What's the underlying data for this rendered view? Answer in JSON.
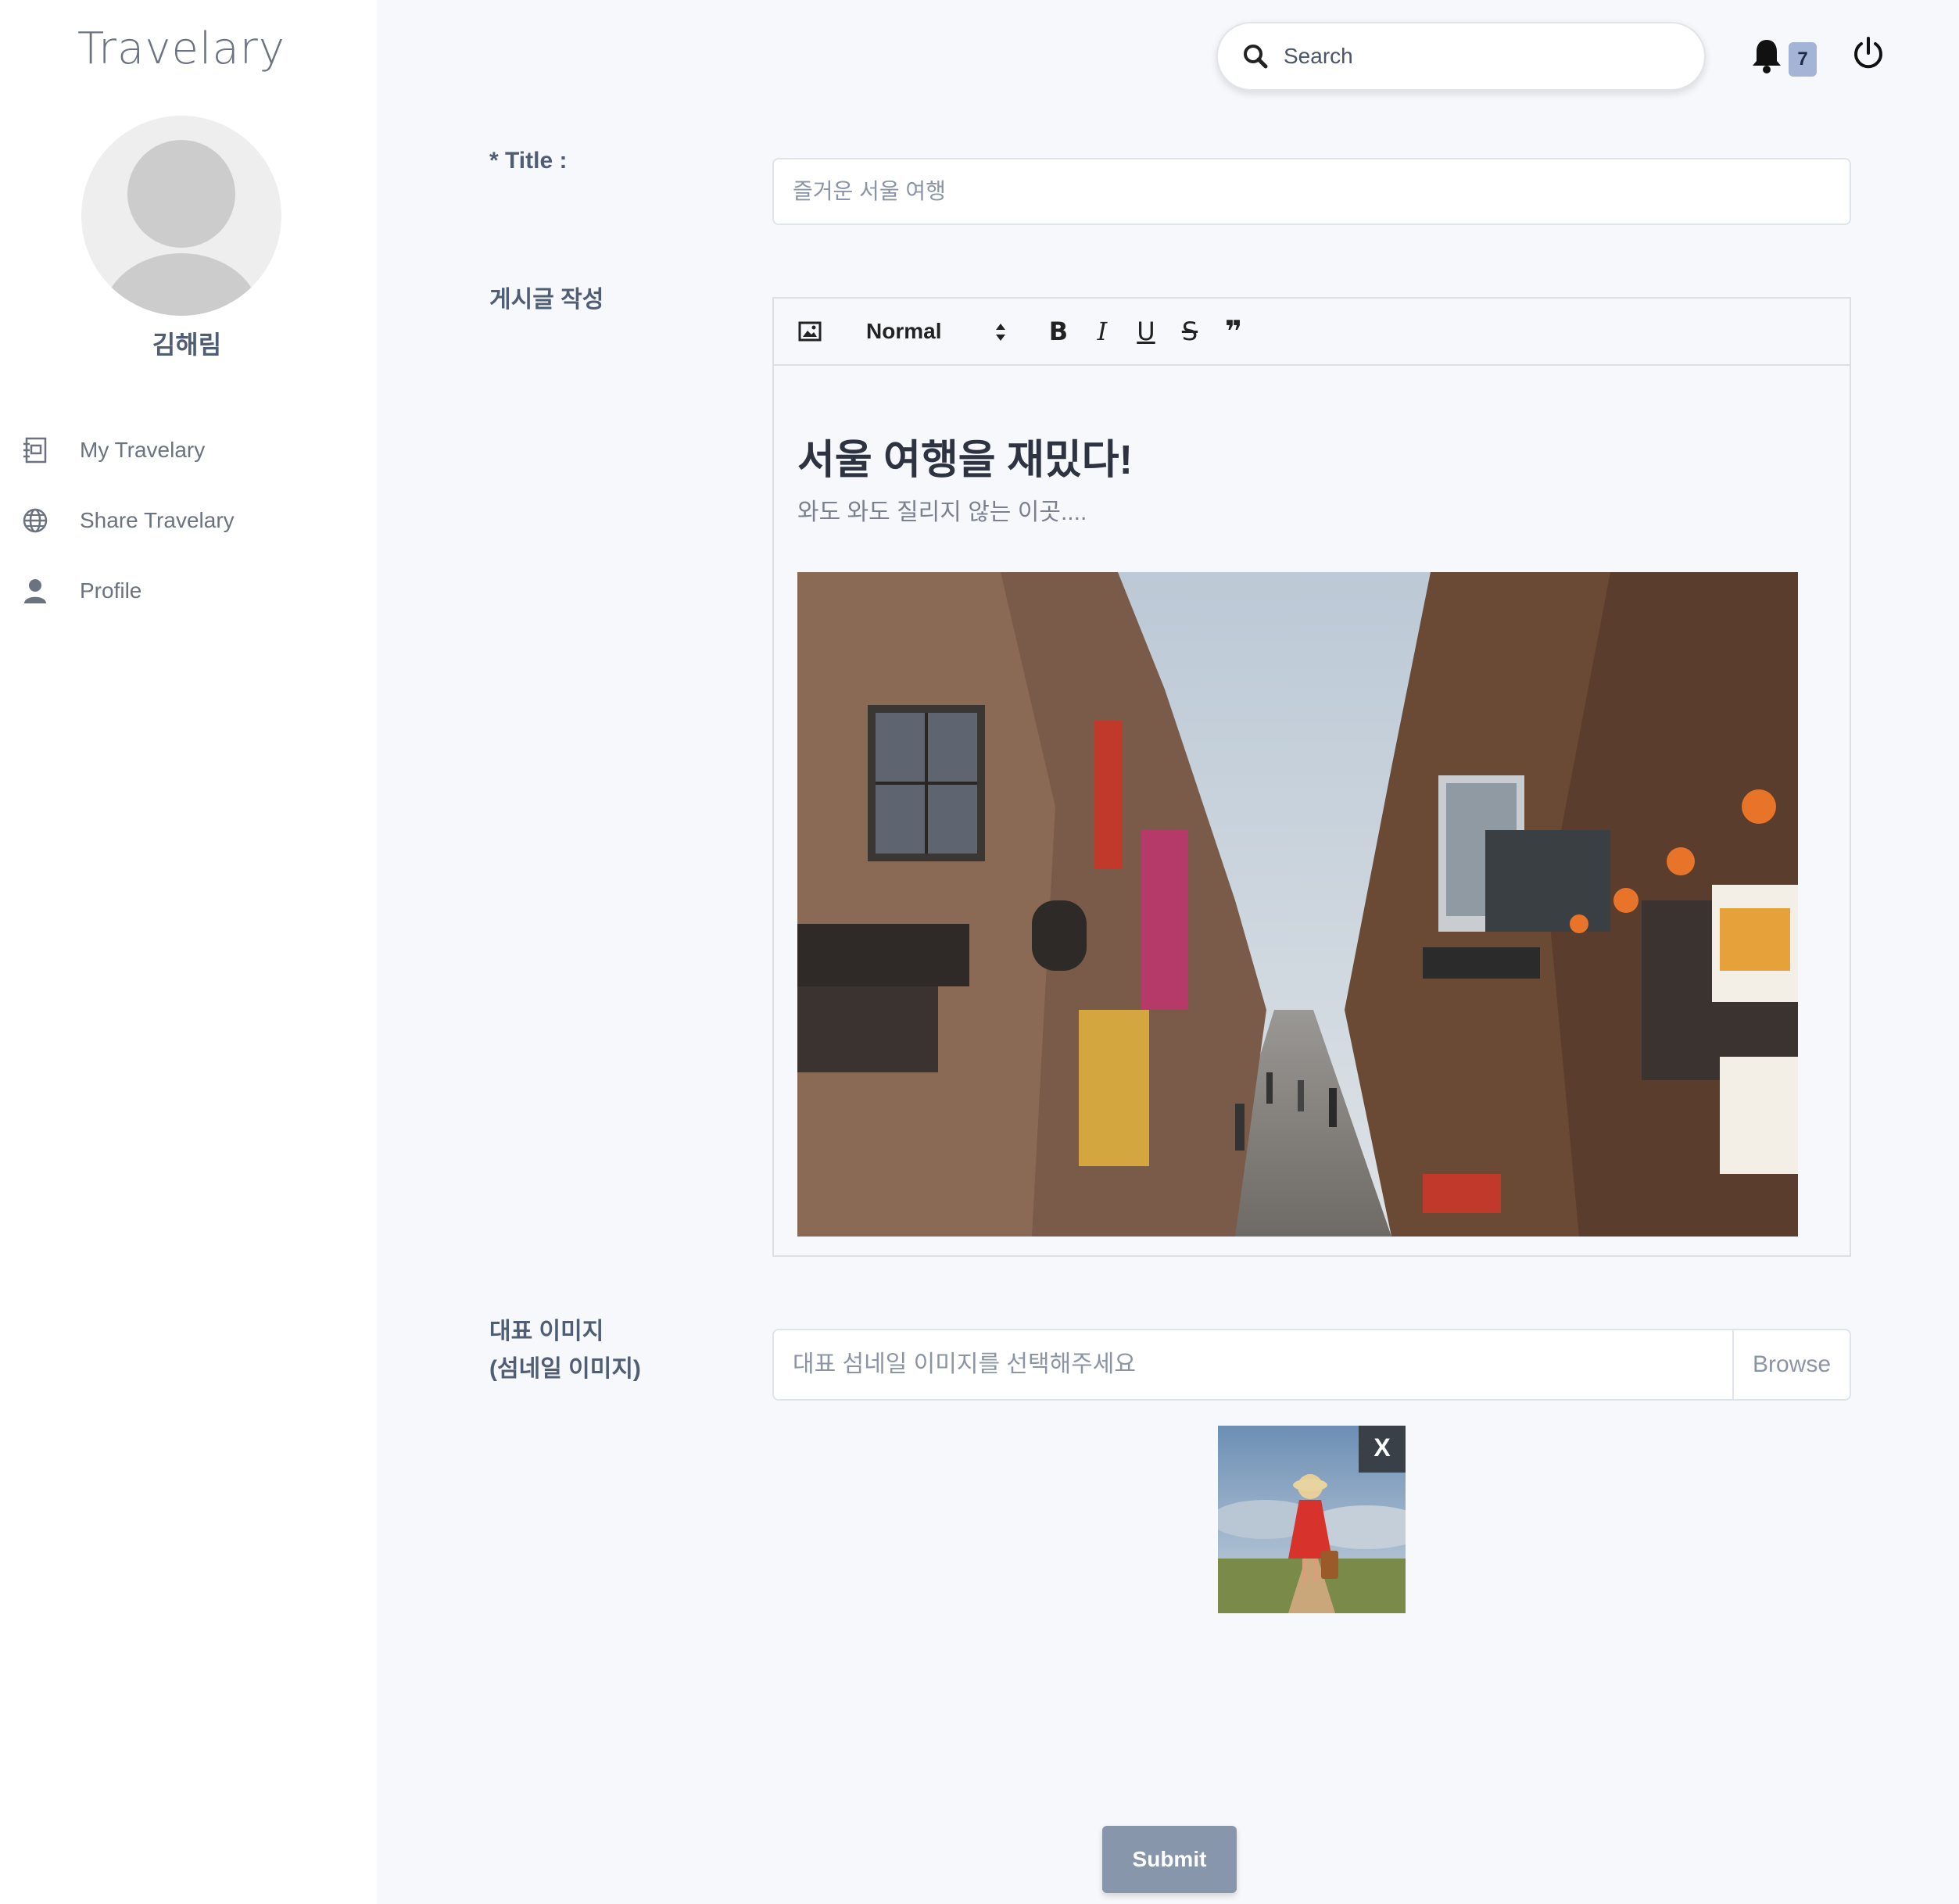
{
  "app": {
    "brand": "Travelary"
  },
  "sidebar": {
    "username": "김해림",
    "items": [
      {
        "label": "My Travelary",
        "icon": "notebook-icon"
      },
      {
        "label": "Share Travelary",
        "icon": "globe-icon"
      },
      {
        "label": "Profile",
        "icon": "user-icon"
      }
    ]
  },
  "topbar": {
    "search_placeholder": "Search",
    "notification_count": "7",
    "icons": [
      "search-icon",
      "bell-icon",
      "power-icon"
    ]
  },
  "form": {
    "title_label": "* Title :",
    "title_value": "즐거운 서울 여행",
    "content_label": "게시글 작성",
    "editor": {
      "toolbar": {
        "image_icon": "image-icon",
        "format_select": "Normal",
        "bold": "B",
        "italic": "I",
        "underline": "U",
        "strike": "S",
        "quote": "❞"
      },
      "heading": "서울 여행을 재밌다!",
      "subtext": "와도 와도 질리지 않는 이곳....",
      "photo": "street-photo"
    },
    "thumbnail_label_1": "대표 이미지",
    "thumbnail_label_2": "(섬네일 이미지)",
    "thumbnail_placeholder": "대표 섬네일 이미지를 선택해주세요",
    "browse_label": "Browse",
    "thumbnail_remove": "X",
    "submit_label": "Submit"
  },
  "colors": {
    "accent": "#8796aa",
    "badge": "#a3b4d7",
    "label": "#4f5d75",
    "background": "#f7f8fc"
  }
}
